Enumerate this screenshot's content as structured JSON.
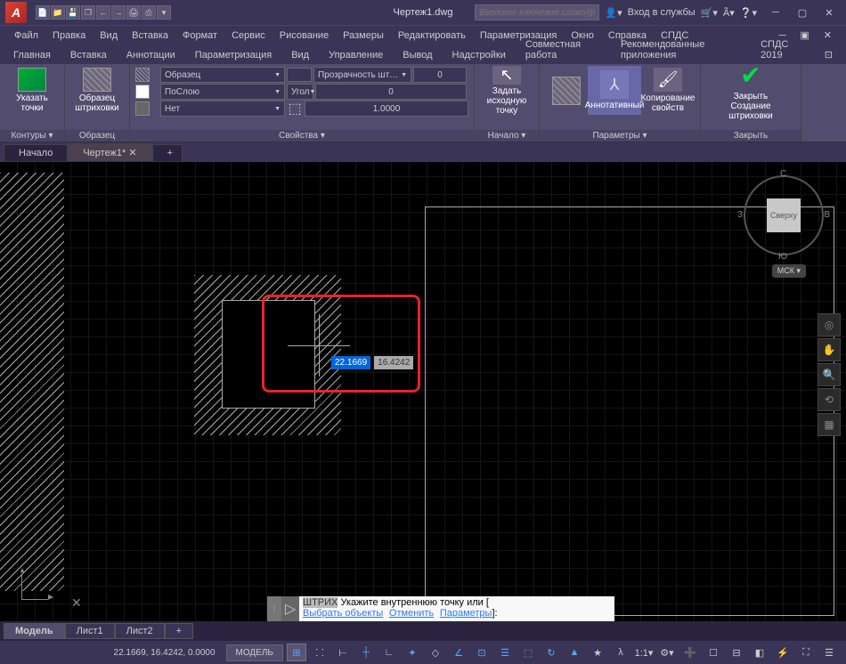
{
  "title": "Чертеж1.dwg",
  "app_letter": "A",
  "quick_access": [
    "📄",
    "📁",
    "💾",
    "❐",
    "←",
    "→",
    "🖨",
    "⎙"
  ],
  "search_placeholder": "Введите ключевое слово/фразу",
  "signin_label": "Вход в службы",
  "menubar": [
    "Файл",
    "Правка",
    "Вид",
    "Вставка",
    "Формат",
    "Сервис",
    "Рисование",
    "Размеры",
    "Редактировать",
    "Параметризация",
    "Окно",
    "Справка",
    "СПДС"
  ],
  "ribbon_tabs": [
    "Главная",
    "Вставка",
    "Аннотации",
    "Параметризация",
    "Вид",
    "Управление",
    "Вывод",
    "Надстройки",
    "Совместная работа",
    "Рекомендованные приложения",
    "СПДС 2019"
  ],
  "ribbon": {
    "pick_points": "Указать точки",
    "panel1": "Контуры ▾",
    "hatch_pattern": "Образец\nштриховки",
    "panel2": "Образец",
    "pattern_drop": "Образец",
    "color_drop": "ПоСлою",
    "no_drop": "Нет",
    "transparency": "Прозрачность шт…",
    "transparency_val": "0",
    "angle": "Угол",
    "angle_val": "0",
    "scale_val": "1.0000",
    "panel3": "Свойства ▾",
    "set_origin": "Задать\nисходную точку",
    "panel4": "Начало ▾",
    "annotative": "Аннотативный",
    "copy_props": "Копирование\nсвойств",
    "panel5": "Параметры ▾",
    "close_label": "Закрыть\nСоздание штриховки",
    "panel6": "Закрыть"
  },
  "doc_tabs": {
    "start": "Начало",
    "active": "Чертеж1*"
  },
  "canvas": {
    "coord_x": "22.1669",
    "coord_y": "16.4242"
  },
  "viewcube": {
    "face": "Сверху",
    "n": "С",
    "s": "Ю",
    "w": "З",
    "e": "В",
    "wcs": "МСК ▾"
  },
  "cmdline": {
    "cmd": "ШТРИХ",
    "line1_text": " Укажите внутреннюю точку или [",
    "line2_a": "Выбрать объекты",
    "line2_b": "Отменить",
    "line2_c": "Параметры",
    "line2_end": "]:"
  },
  "layout_tabs": [
    "Модель",
    "Лист1",
    "Лист2"
  ],
  "statusbar": {
    "coords": "22.1669, 16.4242, 0.0000",
    "model": "МОДЕЛЬ"
  }
}
